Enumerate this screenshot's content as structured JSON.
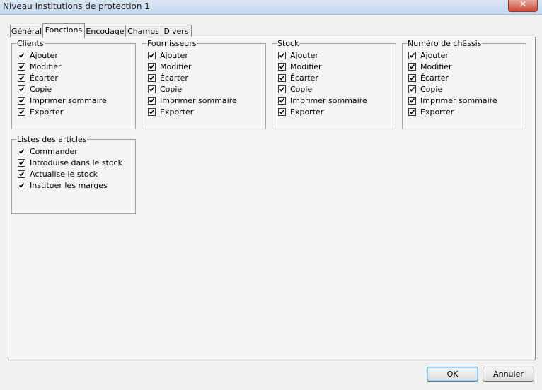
{
  "window": {
    "title": "Niveau Institutions de protection 1",
    "close_glyph": "✕"
  },
  "tabs": [
    {
      "label": "Général",
      "active": false
    },
    {
      "label": "Fonctions",
      "active": true
    },
    {
      "label": "Encodage",
      "active": false
    },
    {
      "label": "Champs",
      "active": false
    },
    {
      "label": "Divers",
      "active": false
    }
  ],
  "groups": [
    {
      "title": "Clients",
      "items": [
        "Ajouter",
        "Modifier",
        "Écarter",
        "Copie",
        "Imprimer sommaire",
        "Exporter"
      ],
      "checked": [
        true,
        true,
        true,
        true,
        true,
        true
      ]
    },
    {
      "title": "Fournisseurs",
      "items": [
        "Ajouter",
        "Modifier",
        "Écarter",
        "Copie",
        "Imprimer sommaire",
        "Exporter"
      ],
      "checked": [
        true,
        true,
        true,
        true,
        true,
        true
      ]
    },
    {
      "title": "Stock",
      "items": [
        "Ajouter",
        "Modifier",
        "Écarter",
        "Copie",
        "Imprimer sommaire",
        "Exporter"
      ],
      "checked": [
        true,
        true,
        true,
        true,
        true,
        true
      ]
    },
    {
      "title": "Numéro de châssis",
      "items": [
        "Ajouter",
        "Modifier",
        "Écarter",
        "Copie",
        "Imprimer sommaire",
        "Exporter"
      ],
      "checked": [
        true,
        true,
        true,
        true,
        true,
        true
      ]
    },
    {
      "title": "Listes des articles",
      "items": [
        "Commander",
        "Introduise dans le stock",
        "Actualise le stock",
        "Instituer les marges"
      ],
      "checked": [
        true,
        true,
        true,
        true
      ]
    }
  ],
  "buttons": {
    "ok": "OK",
    "cancel": "Annuler"
  }
}
